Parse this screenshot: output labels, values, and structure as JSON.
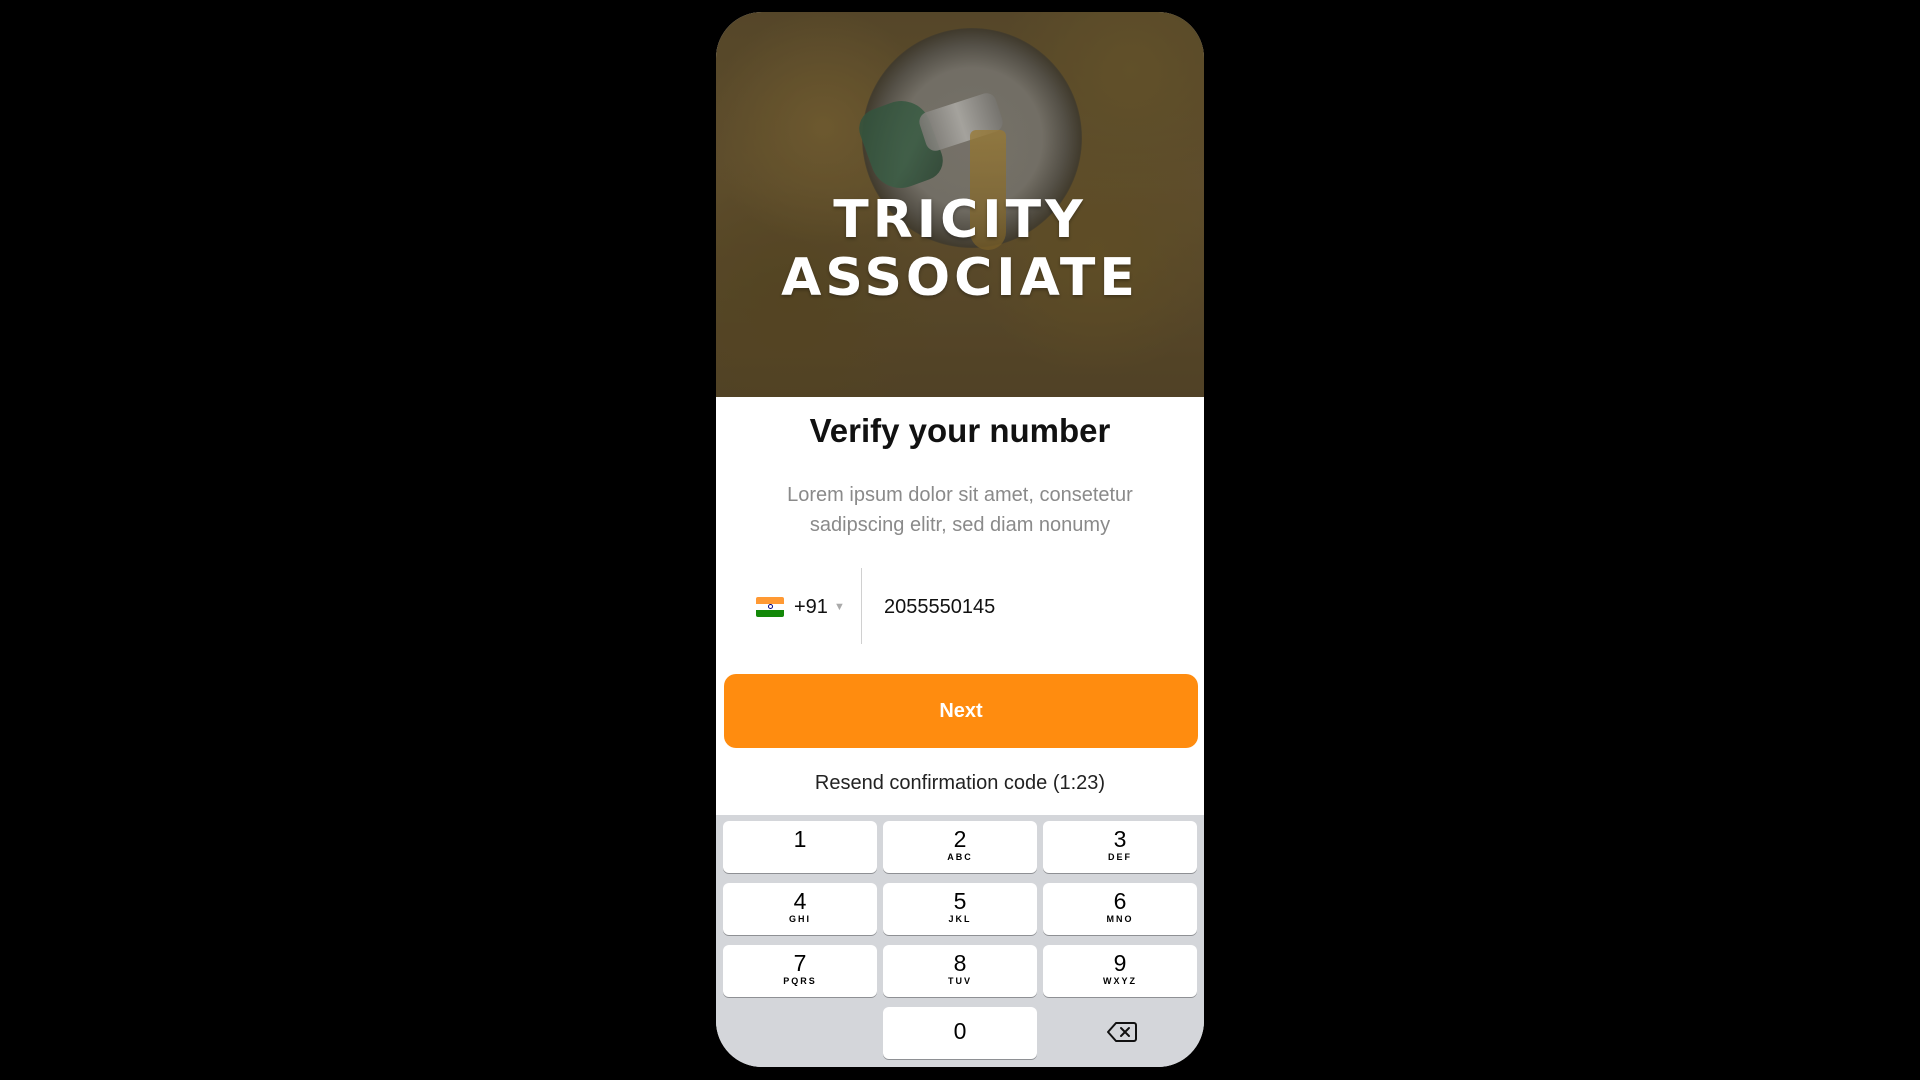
{
  "hero": {
    "brand_line1": "TRICITY",
    "brand_line2": "ASSOCIATE"
  },
  "verify": {
    "title": "Verify your number",
    "subtitle": "Lorem ipsum dolor sit amet, consetetur sadipscing elitr, sed diam nonumy"
  },
  "phone": {
    "country_flag": "india-flag-icon",
    "country_code": "+91",
    "number": "2055550145"
  },
  "actions": {
    "next_label": "Next",
    "resend_label": "Resend confirmation code (1:23)"
  },
  "keypad": {
    "keys": [
      {
        "num": "1",
        "letters": ""
      },
      {
        "num": "2",
        "letters": "ABC"
      },
      {
        "num": "3",
        "letters": "DEF"
      },
      {
        "num": "4",
        "letters": "GHI"
      },
      {
        "num": "5",
        "letters": "JKL"
      },
      {
        "num": "6",
        "letters": "MNO"
      },
      {
        "num": "7",
        "letters": "PQRS"
      },
      {
        "num": "8",
        "letters": "TUV"
      },
      {
        "num": "9",
        "letters": "WXYZ"
      },
      {
        "num": "0",
        "letters": ""
      }
    ],
    "backspace_icon": "backspace-icon"
  },
  "colors": {
    "accent": "#FF8C0F",
    "keypad_bg": "#D4D6DA",
    "background": "#000000"
  }
}
